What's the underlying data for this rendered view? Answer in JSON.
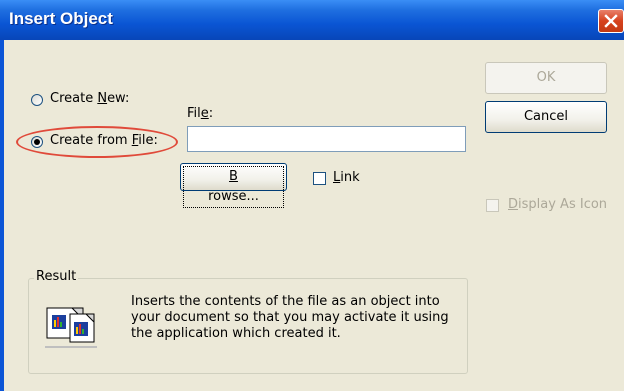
{
  "window": {
    "title": "Insert Object"
  },
  "options": {
    "create_new": {
      "prefix": "Create ",
      "accel": "N",
      "suffix": "ew:"
    },
    "create_from_file": {
      "prefix": "Create from ",
      "accel": "F",
      "suffix": "ile:"
    }
  },
  "file": {
    "label_prefix": "Fil",
    "label_accel": "e",
    "label_suffix": ":",
    "value": "",
    "browse": {
      "accel": "B",
      "suffix": "rowse..."
    },
    "link": {
      "accel": "L",
      "suffix": "ink"
    }
  },
  "buttons": {
    "ok": "OK",
    "cancel": "Cancel"
  },
  "display_as_icon": {
    "accel": "D",
    "suffix": "isplay As Icon"
  },
  "result": {
    "label": "Result",
    "lines": [
      "Inserts the contents of the file as an object into",
      "your document so that you may activate it using",
      "the application which created it."
    ]
  },
  "colors": {
    "highlight": "#e04a3a",
    "title_bar": "#0a55d4"
  }
}
